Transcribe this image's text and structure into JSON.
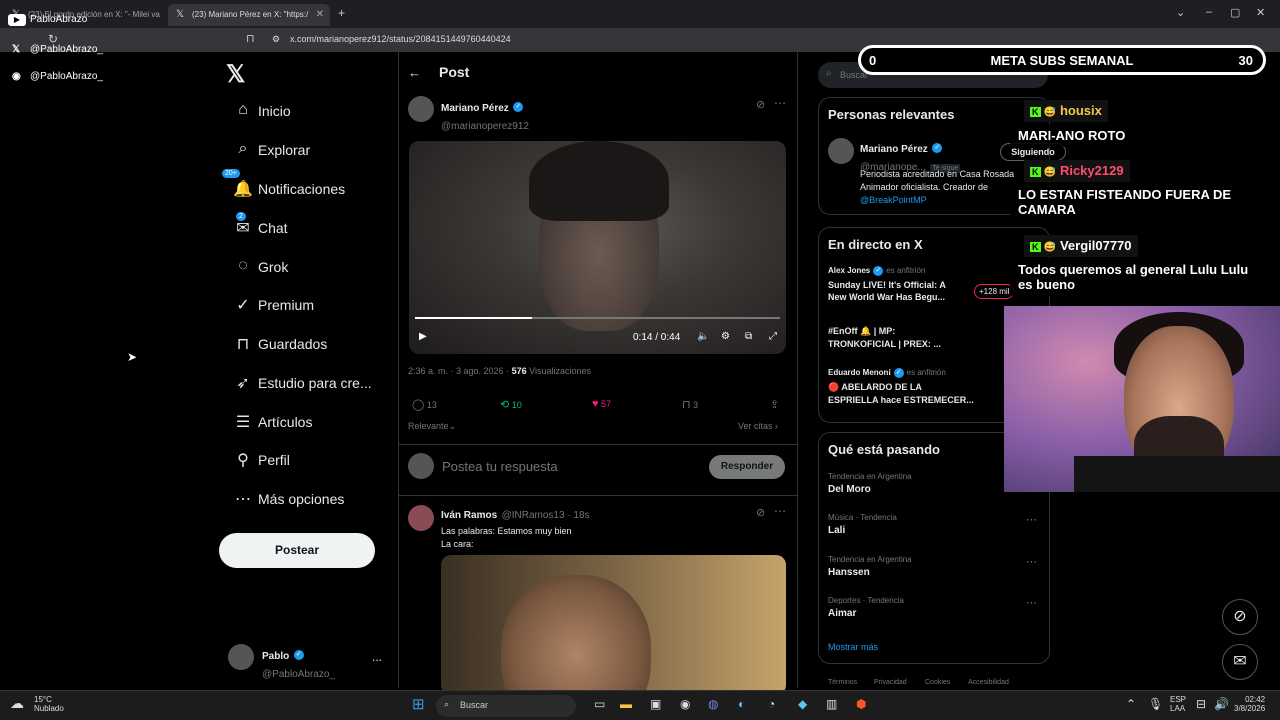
{
  "browser": {
    "tab1_title": "(23) El gordo edición en X: \"- Milei va",
    "tab2_title": "(23) Mariano Pérez en X: \"https:/",
    "new_tab": "+",
    "url": "x.com/marianoperez912/status/2084151449760440424"
  },
  "overlay_left": {
    "yt_channel": "PabloAbrazo",
    "x_handle": "@PabloAbrazo_",
    "discord_handle": "@PabloAbrazo_"
  },
  "nav": {
    "items": [
      {
        "icon": "⌂",
        "label": "Inicio"
      },
      {
        "icon": "⌕",
        "label": "Explorar"
      },
      {
        "icon": "🔔",
        "label": "Notificaciones",
        "badge": "20+"
      },
      {
        "icon": "✉",
        "label": "Chat",
        "badge": "2"
      },
      {
        "icon": "◌",
        "label": "Grok"
      },
      {
        "icon": "✓",
        "label": "Premium"
      },
      {
        "icon": "⊓",
        "label": "Guardados"
      },
      {
        "icon": "➶",
        "label": "Estudio para cre..."
      },
      {
        "icon": "☰",
        "label": "Artículos"
      },
      {
        "icon": "⚲",
        "label": "Perfil"
      },
      {
        "icon": "⋯",
        "label": "Más opciones"
      }
    ],
    "post_button": "Postear",
    "me_name": "Pablo",
    "me_handle": "@PabloAbrazo_",
    "me_more": "..."
  },
  "post": {
    "header": "Post",
    "author_name": "Mariano Pérez",
    "author_handle": "@marianoperez912",
    "video_time": "0:14 / 0:44",
    "video_progress": 0.32,
    "timestamp": "2:36 a. m. · 3 ago. 2026 ·",
    "views_count": "576",
    "views_label": "Visualizaciones",
    "replies": "13",
    "reposts": "10",
    "likes": "57",
    "bookmarks": "3",
    "sort": "Relevante",
    "quotes": "Ver citas",
    "reply_placeholder": "Postea tu respuesta",
    "reply_button": "Responder"
  },
  "reply_post": {
    "name": "Iván Ramos",
    "handle": "@INRamos13 · 18s",
    "line1": "Las palabras: Estamos muy bien",
    "line2": "La cara:"
  },
  "right": {
    "search": "Buscar",
    "relevant_title": "Personas relevantes",
    "rel_name": "Mariano Pérez",
    "rel_handle": "@marianope...",
    "follows_you": "Te sigue",
    "following_button": "Siguiendo",
    "bio1": "Periodista acreditado en Casa Rosada",
    "bio2": "Animador oficialista. Creador de",
    "bio_link": "@BreakPointMP",
    "live_title": "En directo en X",
    "live": [
      {
        "host": "Alex Jones",
        "role": "es anfitrión",
        "title1": "Sunday LIVE! It's Official: A",
        "title2": "New World War Has Begu...",
        "count": "+128 mil"
      },
      {
        "host": "",
        "role": "",
        "title1": "#EnOff 🔔 | MP:",
        "title2": "TRONKOFICIAL | PREX: ...",
        "count": ""
      },
      {
        "host": "Eduardo Menoni",
        "role": "es anfitrión",
        "title1": "🔴 ABELARDO DE LA",
        "title2": "ESPRIELLA hace ESTREMECER...",
        "count": ""
      }
    ],
    "trends_title": "Qué está pasando",
    "trends": [
      {
        "context": "Tendencia en Argentina",
        "name": "Del Moro"
      },
      {
        "context": "Música · Tendencia",
        "name": "Lali"
      },
      {
        "context": "Tendencia en Argentina",
        "name": "Hanssen"
      },
      {
        "context": "Deportes · Tendencia",
        "name": "Aimar"
      }
    ],
    "show_more": "Mostrar más",
    "footer": [
      "Términos",
      "Privacidad",
      "Cookies",
      "Accesibilidad"
    ]
  },
  "stream": {
    "goal_start": "0",
    "goal_label": "META SUBS SEMANAL",
    "goal_end": "30",
    "chat": [
      {
        "user": "housix",
        "color": "#f2c94c",
        "message": "MARI-ANO ROTO"
      },
      {
        "user": "Ricky2129",
        "color": "#ff4d6d",
        "message": "LO ESTAN FISTEANDO FUERA DE CAMARA"
      },
      {
        "user": "Vergil07770",
        "color": "#ffffff",
        "message": "Todos queremos al general Lulu Lulu es bueno"
      }
    ]
  },
  "taskbar": {
    "temp": "15°C",
    "weather": "Nublado",
    "search": "Buscar",
    "lang1": "ESP",
    "lang2": "LAA",
    "time": "02:42",
    "date": "3/8/2026"
  }
}
